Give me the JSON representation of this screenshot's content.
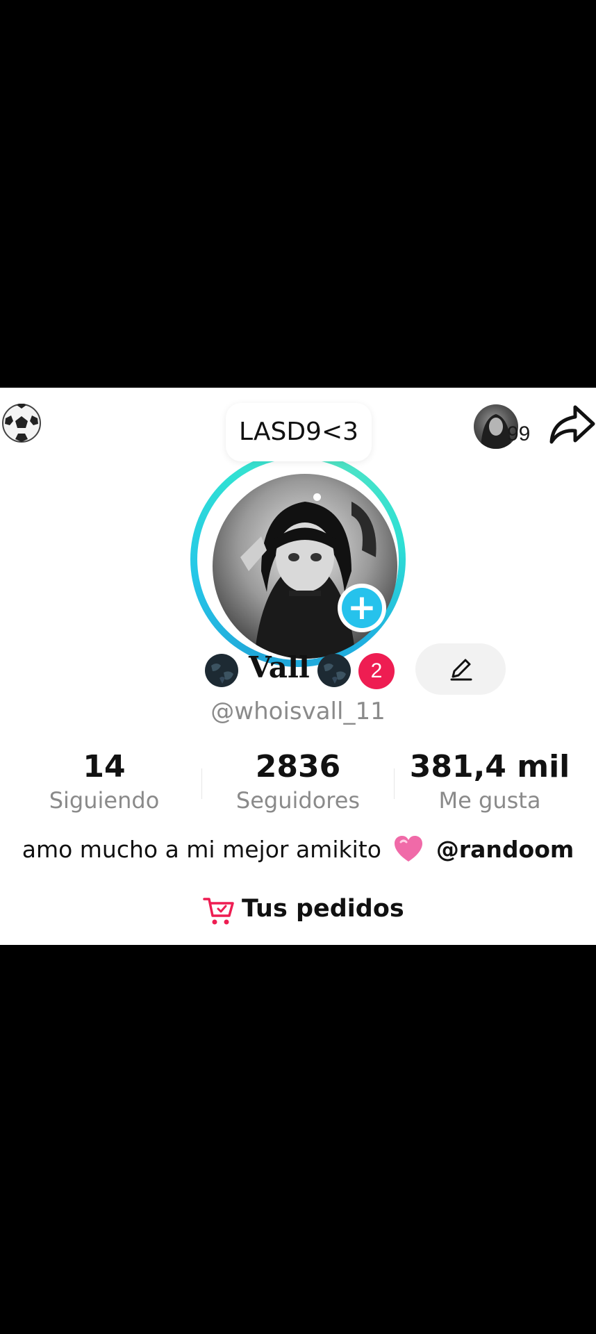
{
  "icons": {
    "top_left": "soccer-ball-icon",
    "share": "share-arrow-icon",
    "add": "plus-icon",
    "edit": "pencil-icon",
    "name_decoration": "globe-icon",
    "bio_emoji": "pink-heart-icon",
    "orders": "shopping-cart-icon"
  },
  "header": {
    "visitor_count": "99"
  },
  "profile": {
    "note": "LASD9<3",
    "name": "Vall",
    "badge_count": "2",
    "handle": "@whoisvall_11"
  },
  "stats": [
    {
      "value": "14",
      "label": "Siguiendo"
    },
    {
      "value": "2836",
      "label": "Seguidores"
    },
    {
      "value": "381,4 mil",
      "label": "Me gusta"
    }
  ],
  "bio": {
    "text": "amo mucho a mi mejor amikito",
    "mention": "@randoom"
  },
  "orders": {
    "label": "Tus pedidos"
  },
  "colors": {
    "background": "#000000",
    "panel": "#ffffff",
    "accent_cyan": "#26c2ec",
    "badge_red": "#ee1d52",
    "cart_pink": "#ee1d52",
    "muted_text": "#8a8a8a"
  }
}
